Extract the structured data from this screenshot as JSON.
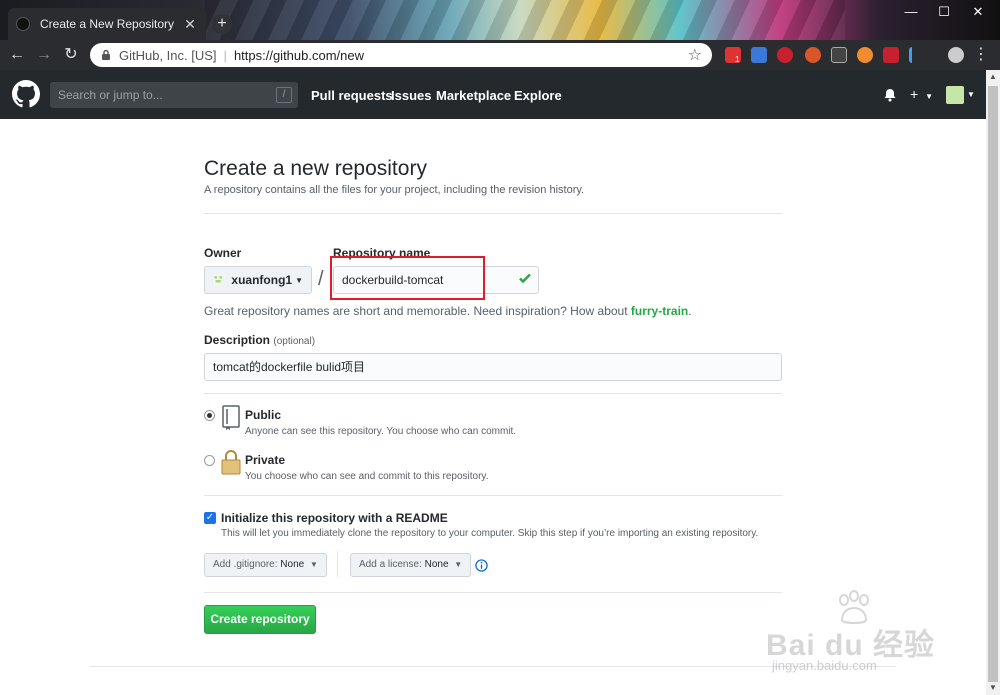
{
  "browser": {
    "tab_title": "Create a New Repository",
    "tab_close": "✕",
    "new_tab": "+",
    "window_controls": [
      "—",
      "☐",
      "✕"
    ],
    "org_label": "GitHub, Inc. [US]",
    "url": "https://github.com/new",
    "extension_badge": "1"
  },
  "github_header": {
    "search_placeholder": "Search or jump to...",
    "search_shortcut": "/",
    "nav": [
      "Pull requests",
      "Issues",
      "Marketplace",
      "Explore"
    ]
  },
  "form": {
    "title": "Create a new repository",
    "subtitle": "A repository contains all the files for your project, including the revision history.",
    "owner_label": "Owner",
    "owner_value": "xuanfong1",
    "slash": "/",
    "repo_name_label": "Repository name",
    "repo_name_value": "dockerbuild-tomcat",
    "hint_prefix": "Great repository names are short and memorable. Need inspiration? How about ",
    "hint_suggestion": "furry-train",
    "hint_suffix": ".",
    "description_label": "Description",
    "description_optional": "(optional)",
    "description_value": "tomcat的dockerfile bulid项目",
    "visibility": {
      "public_title": "Public",
      "public_note": "Anyone can see this repository. You choose who can commit.",
      "private_title": "Private",
      "private_note": "You choose who can see and commit to this repository.",
      "selected": "public"
    },
    "init_readme_label": "Initialize this repository with a README",
    "init_readme_note": "This will let you immediately clone the repository to your computer. Skip this step if you’re importing an existing repository.",
    "init_readme_checked": true,
    "gitignore_label": "Add .gitignore:",
    "gitignore_value": "None",
    "license_label": "Add a license:",
    "license_value": "None",
    "submit_label": "Create repository"
  },
  "watermark": {
    "brand": "Bai du 经验",
    "url": "jingyan.baidu.com"
  },
  "colors": {
    "header_bg": "#24292e",
    "primary_green": "#28a745",
    "highlight_red": "#e21b2c",
    "checkbox_blue": "#1a73e8"
  }
}
